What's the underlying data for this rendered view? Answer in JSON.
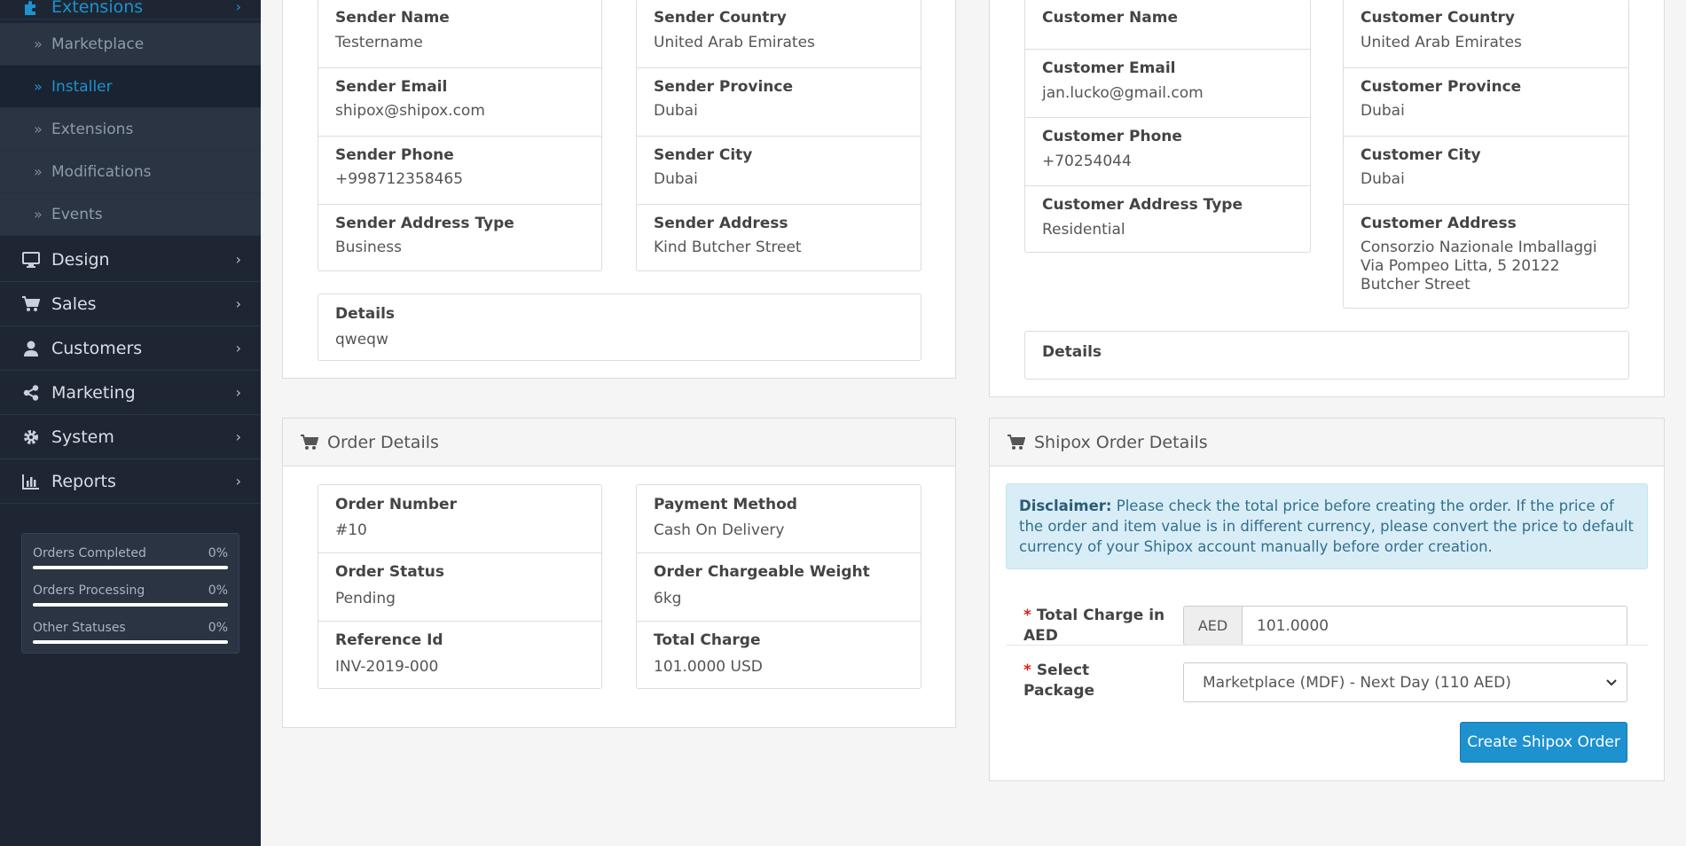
{
  "sidebar": {
    "top_item": "Extensions",
    "subitems": [
      "Marketplace",
      "Installer",
      "Extensions",
      "Modifications",
      "Events"
    ],
    "active_subitem": "Installer",
    "main_items": [
      {
        "label": "Design",
        "icon": "monitor-icon"
      },
      {
        "label": "Sales",
        "icon": "cart-icon"
      },
      {
        "label": "Customers",
        "icon": "user-icon"
      },
      {
        "label": "Marketing",
        "icon": "share-icon"
      },
      {
        "label": "System",
        "icon": "gear-icon"
      },
      {
        "label": "Reports",
        "icon": "bar-chart-icon"
      }
    ],
    "stats": [
      {
        "label": "Orders Completed",
        "value": "0%",
        "progress": 0
      },
      {
        "label": "Orders Processing",
        "value": "0%",
        "progress": 0
      },
      {
        "label": "Other Statuses",
        "value": "0%",
        "progress": 0
      }
    ]
  },
  "sender": {
    "left": [
      {
        "label": "Sender Name",
        "value": "Testername"
      },
      {
        "label": "Sender Email",
        "value": "shipox@shipox.com"
      },
      {
        "label": "Sender Phone",
        "value": "+998712358465"
      },
      {
        "label": "Sender Address Type",
        "value": "Business"
      }
    ],
    "right": [
      {
        "label": "Sender Country",
        "value": "United Arab Emirates"
      },
      {
        "label": "Sender Province",
        "value": "Dubai"
      },
      {
        "label": "Sender City",
        "value": "Dubai"
      },
      {
        "label": "Sender Address",
        "value": "Kind Butcher Street"
      }
    ],
    "details": {
      "label": "Details",
      "value": "qweqw"
    }
  },
  "customer": {
    "left": [
      {
        "label": "Customer Name",
        "value": ""
      },
      {
        "label": "Customer Email",
        "value": "jan.lucko@gmail.com"
      },
      {
        "label": "Customer Phone",
        "value": "+70254044"
      },
      {
        "label": "Customer Address Type",
        "value": "Residential"
      }
    ],
    "right": [
      {
        "label": "Customer Country",
        "value": "United Arab Emirates"
      },
      {
        "label": "Customer Province",
        "value": "Dubai"
      },
      {
        "label": "Customer City",
        "value": "Dubai"
      },
      {
        "label": "Customer Address",
        "value": "Consorzio Nazionale Imballaggi Via Pompeo Litta, 5 20122 Butcher Street"
      }
    ],
    "details": {
      "label": "Details",
      "value": ""
    }
  },
  "order": {
    "title": "Order Details",
    "left": [
      {
        "label": "Order Number",
        "value": "#10"
      },
      {
        "label": "Order Status",
        "value": "Pending"
      },
      {
        "label": "Reference Id",
        "value": "INV-2019-000"
      }
    ],
    "right": [
      {
        "label": "Payment Method",
        "value": "Cash On Delivery"
      },
      {
        "label": "Order Chargeable Weight",
        "value": "6kg"
      },
      {
        "label": "Total Charge",
        "value": "101.0000 USD"
      }
    ]
  },
  "shipox": {
    "title": "Shipox Order Details",
    "disclaimer_label": "Disclaimer:",
    "disclaimer_text": " Please check the total price before creating the order. If the price of the order and item value is in different currency, please convert the price to default currency of your Shipox account manually before order creation.",
    "required_mark": "*",
    "total_label": "Total Charge in AED",
    "currency": "AED",
    "total_value": "101.0000",
    "package_label": "Select Package",
    "package_selected": "Marketplace (MDF) - Next Day (110 AED)",
    "create_button": "Create Shipox Order"
  },
  "colors": {
    "sidebar_bg": "#1e2633",
    "accent": "#1e91cf",
    "alert_bg": "#d9edf7",
    "required": "#e02020"
  }
}
